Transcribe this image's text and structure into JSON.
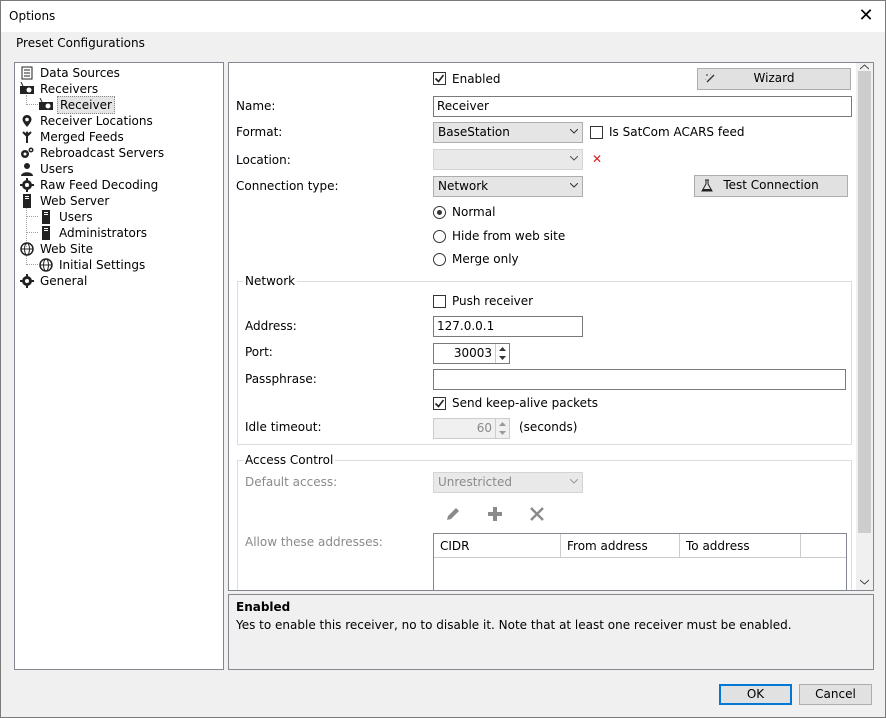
{
  "window": {
    "title": "Options"
  },
  "menu": {
    "preset_label": "Preset Configurations"
  },
  "tree": {
    "items": [
      {
        "label": "Data Sources",
        "icon": "document-icon"
      },
      {
        "label": "Receivers",
        "icon": "receiver-icon"
      },
      {
        "label": "Receiver",
        "icon": "receiver-icon",
        "selected": true
      },
      {
        "label": "Receiver Locations",
        "icon": "map-pin-icon"
      },
      {
        "label": "Merged Feeds",
        "icon": "merge-icon"
      },
      {
        "label": "Rebroadcast Servers",
        "icon": "gears-icon"
      },
      {
        "label": "Users",
        "icon": "users-icon"
      },
      {
        "label": "Raw Feed Decoding",
        "icon": "gear-icon"
      },
      {
        "label": "Web Server",
        "icon": "server-icon"
      },
      {
        "label": "Users",
        "icon": "server-icon"
      },
      {
        "label": "Administrators",
        "icon": "server-icon"
      },
      {
        "label": "Web Site",
        "icon": "globe-icon"
      },
      {
        "label": "Initial Settings",
        "icon": "globe-icon"
      },
      {
        "label": "General",
        "icon": "gear-icon"
      }
    ]
  },
  "receiver": {
    "enabled_label": "Enabled",
    "enabled": true,
    "wizard_label": "Wizard",
    "name_label": "Name:",
    "name_value": "Receiver",
    "format_label": "Format:",
    "format_value": "BaseStation",
    "satcom_label": "Is SatCom ACARS feed",
    "satcom_checked": false,
    "location_label": "Location:",
    "location_value": "",
    "connection_label": "Connection type:",
    "connection_value": "Network",
    "test_connection_label": "Test Connection",
    "radio_options": [
      {
        "label": "Normal",
        "selected": true
      },
      {
        "label": "Hide from web site",
        "selected": false
      },
      {
        "label": "Merge only",
        "selected": false
      }
    ]
  },
  "network": {
    "group_title": "Network",
    "push_label": "Push receiver",
    "push_checked": false,
    "address_label": "Address:",
    "address_value": "127.0.0.1",
    "port_label": "Port:",
    "port_value": "30003",
    "passphrase_label": "Passphrase:",
    "passphrase_value": "",
    "keepalive_label": "Send keep-alive packets",
    "keepalive_checked": true,
    "idle_label": "Idle timeout:",
    "idle_value": "60",
    "idle_units": "(seconds)"
  },
  "access": {
    "group_title": "Access Control",
    "default_label": "Default access:",
    "default_value": "Unrestricted",
    "allow_label": "Allow these addresses:",
    "columns": [
      "CIDR",
      "From address",
      "To address"
    ]
  },
  "help": {
    "title": "Enabled",
    "text": "Yes to enable this receiver, no to disable it. Note that at least one receiver must be enabled."
  },
  "footer": {
    "ok_label": "OK",
    "cancel_label": "Cancel"
  }
}
